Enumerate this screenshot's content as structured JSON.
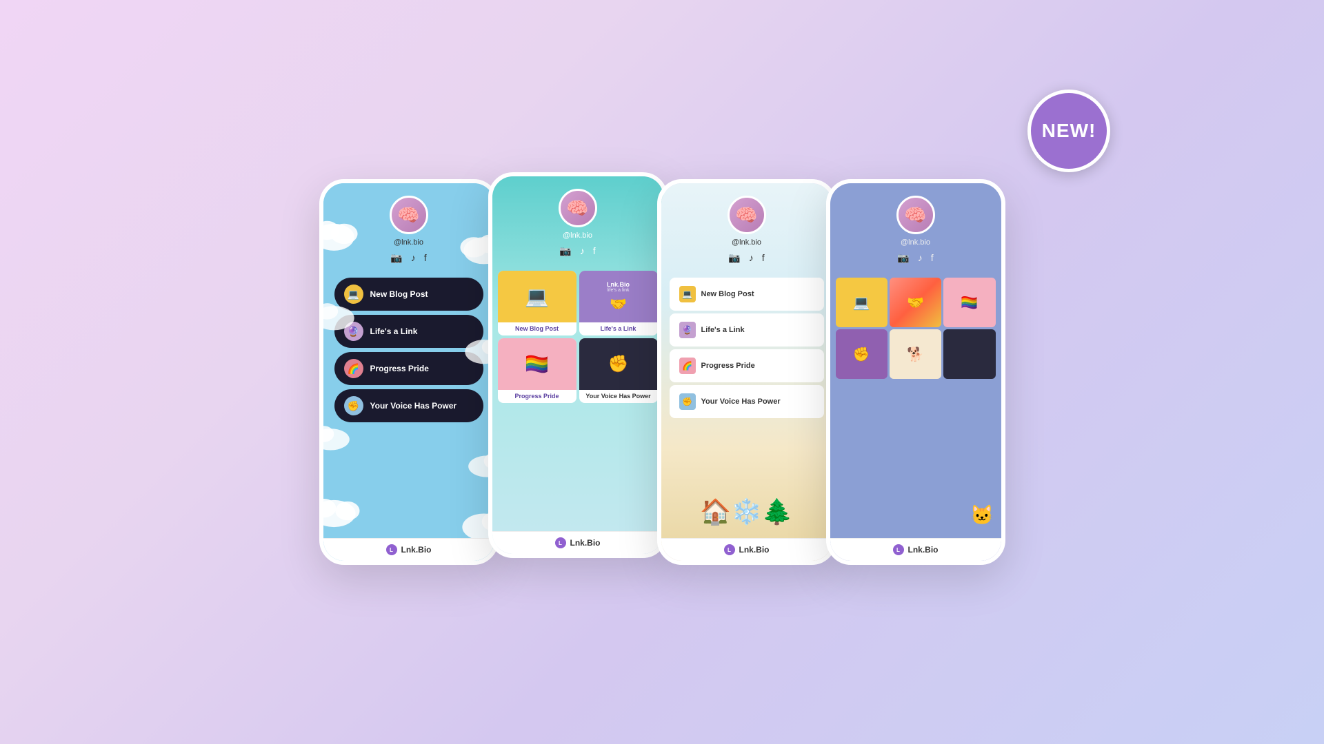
{
  "page": {
    "background": "lavender-gradient",
    "new_badge": "NEW!"
  },
  "phones": [
    {
      "id": "phone-1",
      "theme": "sky-blue-clouds",
      "username": "@lnk.bio",
      "social": [
        "instagram",
        "tiktok",
        "facebook"
      ],
      "links": [
        {
          "label": "New Blog Post",
          "icon": "💻"
        },
        {
          "label": "Life's a Link",
          "icon": "🔮"
        },
        {
          "label": "Progress Pride",
          "icon": "🏳️‍🌈"
        },
        {
          "label": "Your Voice Has Power",
          "icon": "✊"
        }
      ],
      "footer": "Lnk.Bio"
    },
    {
      "id": "phone-2",
      "theme": "teal-gradient",
      "username": "@lnk.bio",
      "social": [
        "instagram",
        "tiktok",
        "facebook"
      ],
      "grid": [
        {
          "label": "New Blog Post",
          "bg": "yellow"
        },
        {
          "label": "Life's a Link",
          "bg": "purple"
        },
        {
          "label": "Progress Pride",
          "bg": "pink"
        },
        {
          "label": "Your Voice Has Power",
          "bg": "dark"
        }
      ],
      "footer": "Lnk.Bio"
    },
    {
      "id": "phone-3",
      "theme": "light-gradient",
      "username": "@lnk.bio",
      "social": [
        "instagram",
        "tiktok",
        "facebook"
      ],
      "links": [
        {
          "label": "New Blog Post",
          "icon": "💻"
        },
        {
          "label": "Life's a Link",
          "icon": "🔮"
        },
        {
          "label": "Progress Pride",
          "icon": "🏳️‍🌈"
        },
        {
          "label": "Your Voice Has Power",
          "icon": "✊"
        }
      ],
      "footer": "Lnk.Bio"
    },
    {
      "id": "phone-4",
      "theme": "periwinkle",
      "username": "@lnk.bio",
      "social": [
        "instagram",
        "tiktok",
        "facebook"
      ],
      "mosaic": [
        {
          "emoji": "💻",
          "bg": "yellow"
        },
        {
          "emoji": "🤝",
          "bg": "rainbow"
        },
        {
          "emoji": "🏳️‍🌈",
          "bg": "pink"
        },
        {
          "emoji": "✊",
          "bg": "purple"
        },
        {
          "emoji": "🐕",
          "bg": "cream"
        },
        {
          "emoji": "⬛",
          "bg": "dark"
        }
      ],
      "footer": "Lnk.Bio"
    }
  ]
}
